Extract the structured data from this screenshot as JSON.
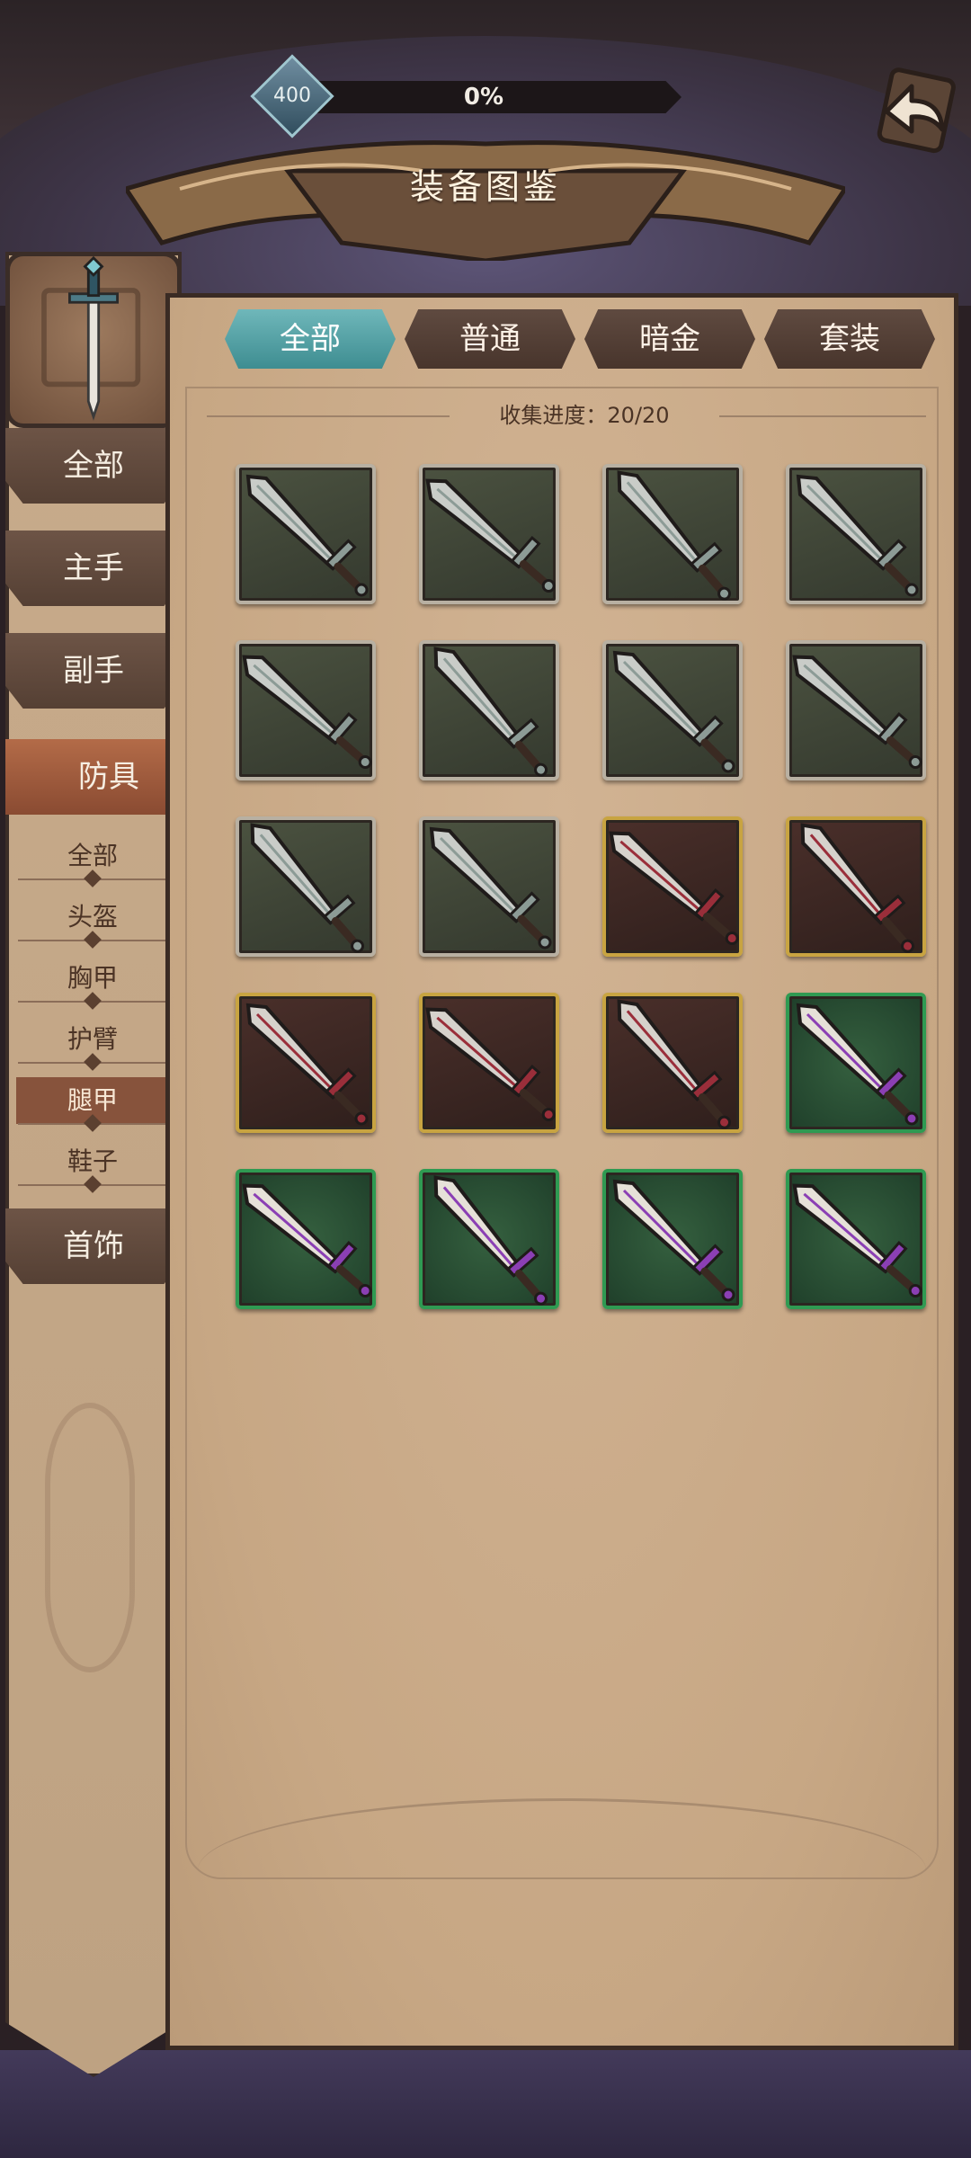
{
  "header": {
    "level": "400",
    "progress_text": "0%",
    "progress": 0
  },
  "title": "装备图鉴",
  "left_tabs": [
    {
      "label": "全部"
    },
    {
      "label": "主手"
    },
    {
      "label": "副手"
    },
    {
      "label": "防具"
    },
    {
      "label": "首饰"
    }
  ],
  "sub_tabs": [
    {
      "label": "全部"
    },
    {
      "label": "头盔"
    },
    {
      "label": "胸甲"
    },
    {
      "label": "护臂"
    },
    {
      "label": "腿甲"
    },
    {
      "label": "鞋子"
    }
  ],
  "top_tabs": [
    {
      "label": "全部"
    },
    {
      "label": "普通"
    },
    {
      "label": "暗金"
    },
    {
      "label": "套装"
    }
  ],
  "collection_progress": "收集进度：20/20",
  "colors": {
    "normal_frame": "#b8b0a2",
    "dark_gold_frame": "#c8a441",
    "set_frame": "#2f9a52",
    "active_tab": "#3e8d91",
    "active_side_tab": "#8a4b32"
  },
  "items": [
    {
      "rarity": "normal",
      "icon": "sword-icon"
    },
    {
      "rarity": "normal",
      "icon": "sword-icon"
    },
    {
      "rarity": "normal",
      "icon": "katana-icon"
    },
    {
      "rarity": "normal",
      "icon": "scimitar-icon"
    },
    {
      "rarity": "normal",
      "icon": "dagger-icon"
    },
    {
      "rarity": "normal",
      "icon": "cleaver-icon"
    },
    {
      "rarity": "normal",
      "icon": "katana-icon"
    },
    {
      "rarity": "normal",
      "icon": "wavy-blade-icon"
    },
    {
      "rarity": "normal",
      "icon": "curved-blade-icon"
    },
    {
      "rarity": "normal",
      "icon": "sword-icon"
    },
    {
      "rarity": "dark",
      "icon": "greatsword-icon"
    },
    {
      "rarity": "dark",
      "icon": "spiked-sword-icon"
    },
    {
      "rarity": "dark",
      "icon": "sword-icon"
    },
    {
      "rarity": "dark",
      "icon": "skull-blade-icon"
    },
    {
      "rarity": "dark",
      "icon": "sword-icon"
    },
    {
      "rarity": "set",
      "icon": "demon-blade-icon"
    },
    {
      "rarity": "set",
      "icon": "ornate-sword-icon"
    },
    {
      "rarity": "set",
      "icon": "flame-blade-icon"
    },
    {
      "rarity": "set",
      "icon": "sword-icon"
    },
    {
      "rarity": "set",
      "icon": "spiked-sword-icon"
    }
  ]
}
